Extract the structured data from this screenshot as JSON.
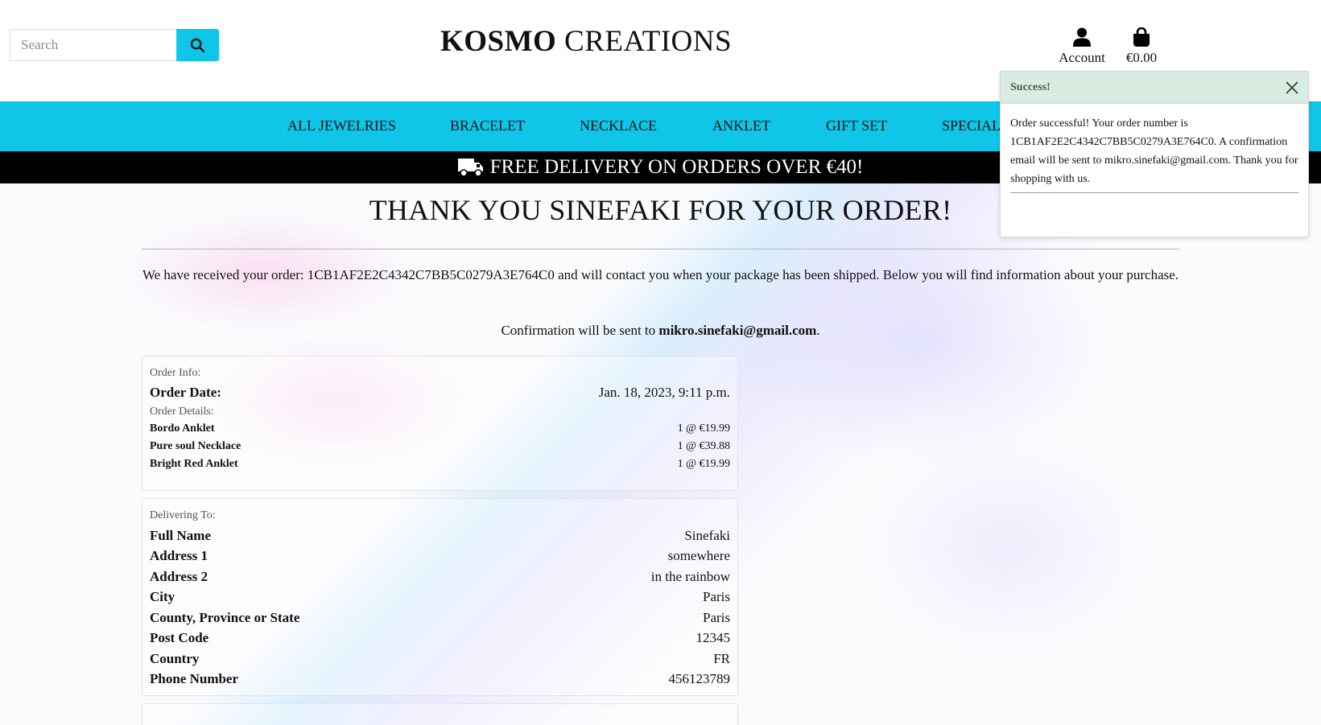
{
  "header": {
    "search": {
      "placeholder": "Search",
      "value": ""
    },
    "brand_bold": "KOSMO",
    "brand_rest": " CREATIONS",
    "account_label": "Account",
    "cart_total": "€0.00"
  },
  "nav": {
    "items": [
      "ALL JEWELRIES",
      "BRACELET",
      "NECKLACE",
      "ANKLET",
      "GIFT SET",
      "SPECIAL"
    ]
  },
  "banner": {
    "text": "FREE DELIVERY ON ORDERS OVER €40!"
  },
  "main": {
    "title": "THANK YOU SINEFAKI FOR YOUR ORDER!",
    "intro": "We have received your order: 1CB1AF2E2C4342C7BB5C0279A3E764C0 and will contact you when your package has been shipped. Below you will find information about your purchase.",
    "confirm_prefix": "Confirmation will be sent to ",
    "confirm_email": "mikro.sinefaki@gmail.com",
    "confirm_suffix": "."
  },
  "order_info": {
    "label": "Order Info:",
    "date_label": "Order Date:",
    "date_value": "Jan. 18, 2023, 9:11 p.m.",
    "details_label": "Order Details:",
    "items": [
      {
        "name": "Bordo Anklet",
        "qty_price": "1 @ €19.99"
      },
      {
        "name": "Pure soul Necklace",
        "qty_price": "1 @ €39.88"
      },
      {
        "name": "Bright Red Anklet",
        "qty_price": "1 @ €19.99"
      }
    ]
  },
  "delivery": {
    "label": "Delivering To:",
    "rows": [
      {
        "k": "Full Name",
        "v": "Sinefaki"
      },
      {
        "k": "Address 1",
        "v": "somewhere"
      },
      {
        "k": "Address 2",
        "v": "in the rainbow"
      },
      {
        "k": "City",
        "v": "Paris"
      },
      {
        "k": "County, Province or State",
        "v": "Paris"
      },
      {
        "k": "Post Code",
        "v": "12345"
      },
      {
        "k": "Country",
        "v": "FR"
      },
      {
        "k": "Phone Number",
        "v": "456123789"
      }
    ]
  },
  "toast": {
    "title": "Success!",
    "message": "Order successful! Your order number is 1CB1AF2E2C4342C7BB5C0279A3E764C0. A confirmation email will be sent to mikro.sinefaki@gmail.com. Thank you for shopping with us."
  },
  "colors": {
    "accent": "#0fc6e9",
    "banner_bg": "#000000",
    "toast_header": "#d9ece2"
  },
  "icons": {
    "search": "search-icon",
    "account": "user-icon",
    "cart": "shopping-bag-icon",
    "banner": "truck-icon",
    "toast_close": "close-icon"
  }
}
